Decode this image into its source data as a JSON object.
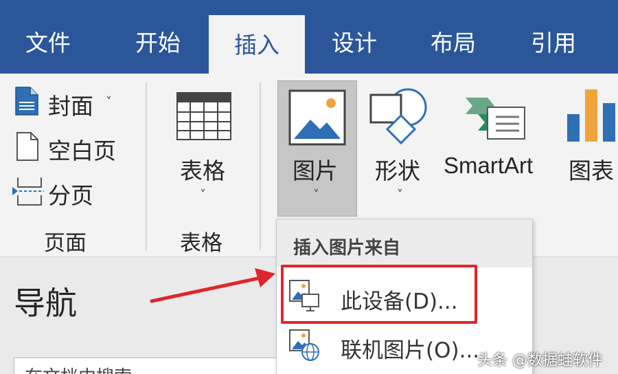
{
  "tabs": [
    {
      "label": "文件",
      "active": false
    },
    {
      "label": "开始",
      "active": false
    },
    {
      "label": "插入",
      "active": true
    },
    {
      "label": "设计",
      "active": false
    },
    {
      "label": "布局",
      "active": false
    },
    {
      "label": "引用",
      "active": false
    }
  ],
  "ribbon": {
    "pages": {
      "cover": "封面",
      "blank_page": "空白页",
      "page_break": "分页",
      "group_label": "页面"
    },
    "tables": {
      "table": "表格",
      "group_label": "表格"
    },
    "illustrations": {
      "pictures": "图片",
      "shapes": "形状",
      "smartart": "SmartArt",
      "chart": "图表"
    }
  },
  "dropdown": {
    "header": "插入图片来自",
    "items": [
      {
        "label": "此设备(D)...",
        "icon": "device-picture-icon"
      },
      {
        "label": "联机图片(O)...",
        "icon": "online-picture-icon"
      }
    ]
  },
  "navigation": {
    "title": "导航",
    "search_placeholder": "在文档中搜索"
  },
  "watermark": "头条 @数据蛙软件",
  "colors": {
    "tab_bar": "#2b579a",
    "highlight": "#e0262b",
    "arrow": "#e0262b"
  }
}
